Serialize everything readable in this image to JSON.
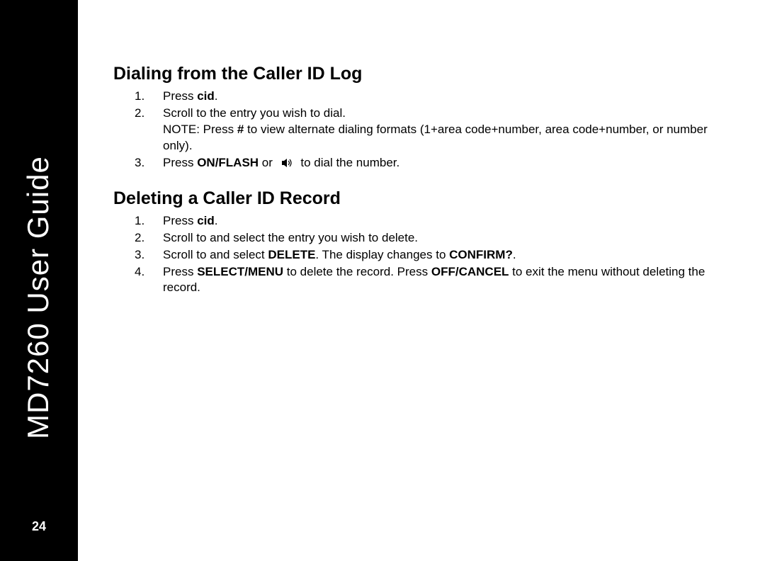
{
  "sidebar": {
    "title": "MD7260 User Guide",
    "page_number": "24"
  },
  "sections": [
    {
      "heading": "Dialing from the Caller ID Log",
      "steps": [
        {
          "num": "1.",
          "parts": [
            {
              "t": "Press ",
              "b": false
            },
            {
              "t": "cid",
              "b": true
            },
            {
              "t": ".",
              "b": false
            }
          ]
        },
        {
          "num": "2.",
          "parts": [
            {
              "t": "Scroll to the entry you wish to dial.",
              "b": false
            }
          ],
          "note": [
            {
              "t": "NOTE: Press ",
              "b": false
            },
            {
              "t": "#",
              "b": true
            },
            {
              "t": " to view alternate dialing formats (1+area code+number, area code+number, or number only).",
              "b": false
            }
          ]
        },
        {
          "num": "3.",
          "parts": [
            {
              "t": "Press ",
              "b": false
            },
            {
              "t": "ON/FLASH",
              "b": true
            },
            {
              "t": " or ",
              "b": false
            },
            {
              "icon": "speaker"
            },
            {
              "t": " to dial the number.",
              "b": false
            }
          ]
        }
      ]
    },
    {
      "heading": "Deleting a Caller ID Record",
      "steps": [
        {
          "num": "1.",
          "parts": [
            {
              "t": "Press ",
              "b": false
            },
            {
              "t": "cid",
              "b": true
            },
            {
              "t": ".",
              "b": false
            }
          ]
        },
        {
          "num": "2.",
          "parts": [
            {
              "t": "Scroll to and select the entry you wish to delete.",
              "b": false
            }
          ]
        },
        {
          "num": "3.",
          "parts": [
            {
              "t": "Scroll to and select ",
              "b": false
            },
            {
              "t": "DELETE",
              "b": true
            },
            {
              "t": ". The display changes to ",
              "b": false
            },
            {
              "t": "CONFIRM?",
              "b": true
            },
            {
              "t": ".",
              "b": false
            }
          ]
        },
        {
          "num": "4.",
          "parts": [
            {
              "t": "Press ",
              "b": false
            },
            {
              "t": "SELECT/MENU",
              "b": true
            },
            {
              "t": " to delete the record. Press ",
              "b": false
            },
            {
              "t": "OFF/CANCEL",
              "b": true
            },
            {
              "t": " to exit the menu without deleting the record.",
              "b": false
            }
          ]
        }
      ]
    }
  ]
}
